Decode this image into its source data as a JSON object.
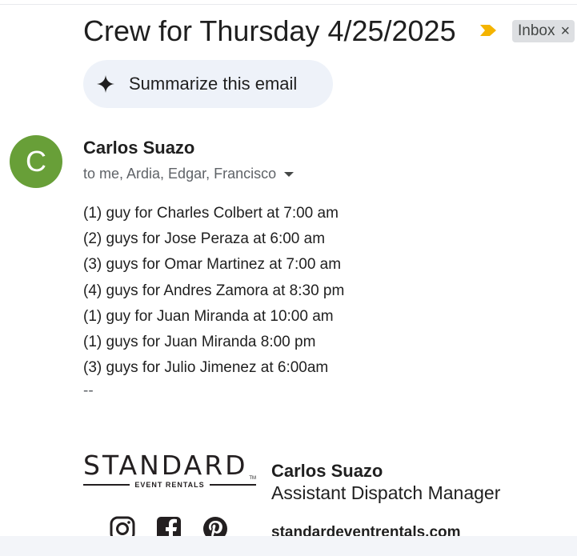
{
  "email": {
    "subject": "Crew for Thursday 4/25/2025",
    "label_chip": "Inbox",
    "label_remove": "×",
    "summarize_label": "Summarize this email",
    "sender_initial": "C",
    "sender_name": "Carlos Suazo",
    "recipients": "to me, Ardia, Edgar, Francisco",
    "body_lines": [
      "(1) guy for Charles Colbert at 7:00 am",
      "(2) guys for Jose Peraza at 6:00 am",
      "(3) guys for Omar Martinez at 7:00 am",
      "(4) guys for Andres Zamora at 8:30 pm",
      "(1) guy for Juan Miranda at 10:00 am",
      "(1) guys for Juan Miranda 8:00 pm",
      "(3) guys for Julio Jimenez at 6:00am"
    ],
    "signature_separator": "--"
  },
  "signature": {
    "logo_word": "STANDARD",
    "logo_sub": "EVENT RENTALS",
    "logo_tm": "TM",
    "name": "Carlos Suazo",
    "title": "Assistant Dispatch Manager",
    "website": "standardeventrentals.com",
    "social_icons": [
      "instagram-icon",
      "facebook-icon",
      "pinterest-icon"
    ]
  },
  "colors": {
    "importance_marker": "#f4b400",
    "avatar": "#689f38",
    "summarize_bg": "#eef2f9",
    "chip_bg": "#dddfe2"
  }
}
